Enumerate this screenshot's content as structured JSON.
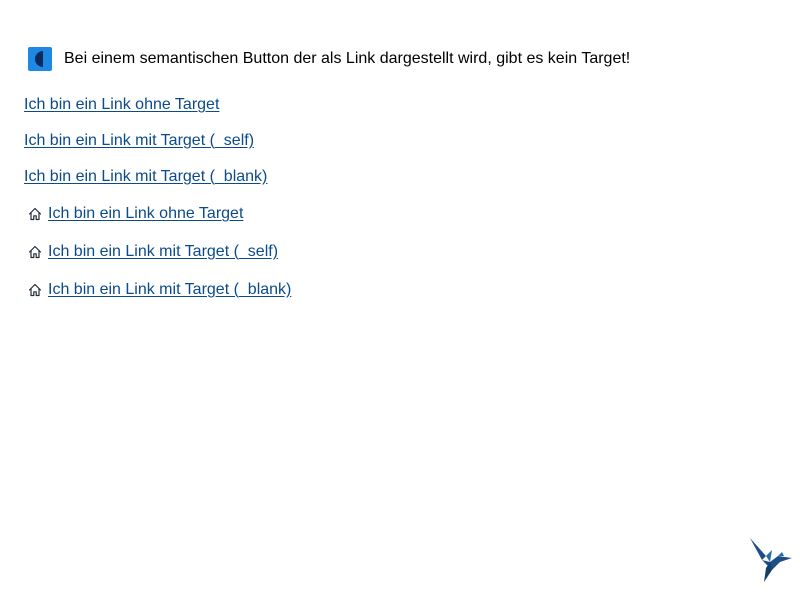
{
  "notice": {
    "icon": "half-moon-contrast-icon",
    "text": "Bei einem semantischen Button der als Link dargestellt wird, gibt es kein Target!"
  },
  "links": [
    {
      "label": "Ich bin ein Link ohne Target"
    },
    {
      "label": "Ich bin ein Link mit Target (_self)"
    },
    {
      "label": "Ich bin ein Link mit Target (_blank)"
    }
  ],
  "icon_links": [
    {
      "icon": "home-icon",
      "label": "Ich bin ein Link ohne Target"
    },
    {
      "icon": "home-icon",
      "label": "Ich bin ein Link mit Target (_self)"
    },
    {
      "icon": "home-icon",
      "label": "Ich bin ein Link mit Target (_blank)"
    }
  ],
  "brand_logo": "hummingbird-logo",
  "colors": {
    "link": "#0b4a8b",
    "notice_icon_bg": "#1e88e5",
    "notice_icon_fg": "#0a2a5c",
    "logo": "#1d4f86"
  }
}
